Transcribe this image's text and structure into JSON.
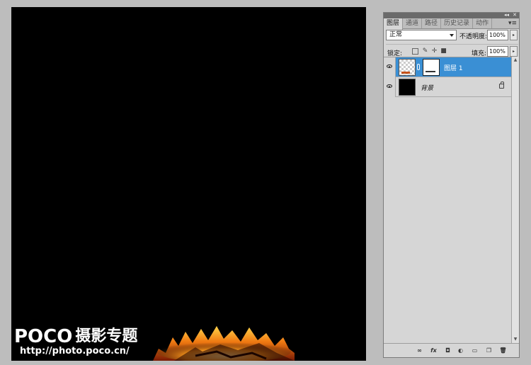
{
  "canvas": {
    "background": "#000000",
    "watermark": {
      "logo": "POCO",
      "logo_cn": "摄影专题",
      "url": "http://photo.poco.cn/"
    }
  },
  "panel": {
    "tabs": [
      {
        "label": "图层",
        "active": true
      },
      {
        "label": "通道",
        "active": false
      },
      {
        "label": "路径",
        "active": false
      },
      {
        "label": "历史记录",
        "active": false
      },
      {
        "label": "动作",
        "active": false
      }
    ],
    "blend_mode": "正常",
    "opacity_label": "不透明度:",
    "opacity_value": "100%",
    "lock_label": "锁定:",
    "fill_label": "填充:",
    "fill_value": "100%",
    "layers": [
      {
        "name": "图层 1",
        "selected": true,
        "has_mask": true
      },
      {
        "name": "背景",
        "selected": false,
        "locked": true
      }
    ],
    "accent_color": "#3a8fd4"
  }
}
